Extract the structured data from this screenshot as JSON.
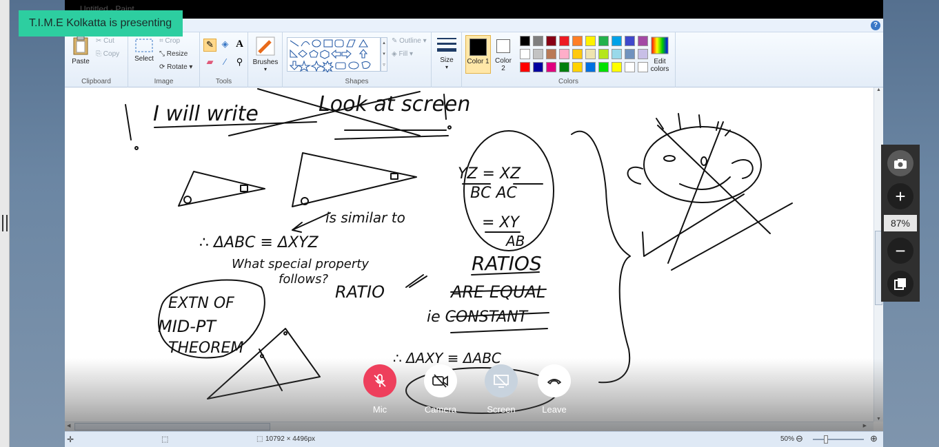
{
  "presenter_banner": "T.I.M.E Kolkatta is presenting",
  "window": {
    "title": "Untitled - Paint"
  },
  "ribbon": {
    "clipboard": {
      "paste": "Paste",
      "cut": "Cut",
      "copy": "Copy",
      "label": "Clipboard"
    },
    "image": {
      "select": "Select",
      "crop": "Crop",
      "resize": "Resize",
      "rotate": "Rotate",
      "label": "Image"
    },
    "tools": {
      "label": "Tools"
    },
    "brushes": "Brushes",
    "shapes": {
      "outline": "Outline",
      "fill": "Fill",
      "label": "Shapes"
    },
    "size": "Size",
    "color1": "Color 1",
    "color2": "Color 2",
    "colors_label": "Colors",
    "edit_colors": "Edit colors",
    "palette": [
      "#000000",
      "#7f7f7f",
      "#880015",
      "#ed1c24",
      "#ff7f27",
      "#fff200",
      "#22b14c",
      "#00a2e8",
      "#3f48cc",
      "#a349a4",
      "#ffffff",
      "#c3c3c3",
      "#b97a57",
      "#ffaec9",
      "#ffc90e",
      "#efe4b0",
      "#b5e61d",
      "#99d9ea",
      "#7092be",
      "#c8bfe7",
      "#ff0000",
      "#0000a0",
      "#e0007f",
      "#007f0e",
      "#ffd200",
      "#0070e0",
      "#00e000",
      "#ffff00",
      "#ffffff",
      "#ffffff"
    ]
  },
  "whiteboard": {
    "line1": "I will write",
    "line2": "Look at screen",
    "ratio1": "YZ = XZ",
    "ratio1b": "BC   AC",
    "ratio2": "= XY",
    "ratio2b": "AB",
    "similar": "is similar to",
    "congruence": "∴ ΔABC ≡ ΔXYZ",
    "question1": "What special property",
    "question2": "follows?",
    "ratio_word": "RATIO",
    "ratios": "RATIOS",
    "are_equal": "ARE EQUAL",
    "ie_constant": "ie CONSTANT",
    "extn": "EXTN OF",
    "midpt": "MID-PT",
    "theorem": "THEOREM",
    "axy": "∴ ΔAXY ≡ ΔABC"
  },
  "status": {
    "dimensions": "10792 × 4496px",
    "zoom": "50%"
  },
  "zoom_panel": {
    "value": "87%"
  },
  "call": {
    "mic": "Mic",
    "camera": "Camera",
    "screen": "Screen",
    "leave": "Leave",
    "mic_color": "#ee3f5c"
  }
}
